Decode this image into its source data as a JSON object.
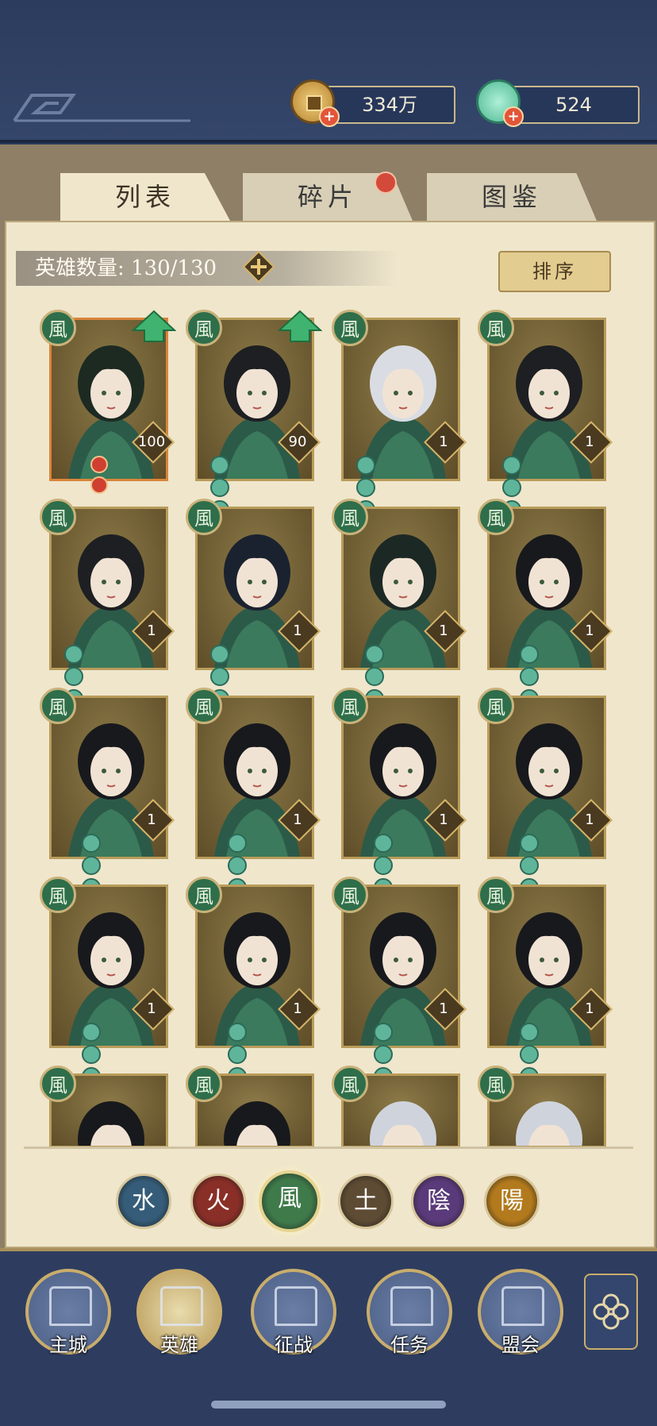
{
  "currency": {
    "coins": {
      "icon": "copper-coin-icon",
      "value": "334万"
    },
    "gems": {
      "icon": "jade-shell-icon",
      "value": "524"
    }
  },
  "tabs": [
    {
      "label": "列表",
      "active": true
    },
    {
      "label": "碎片",
      "active": false,
      "has_notification": true
    },
    {
      "label": "图鉴",
      "active": false
    }
  ],
  "hero_count": {
    "label": "英雄数量:",
    "value": "130/130"
  },
  "sort_button": "排序",
  "heroes": [
    {
      "element": "風",
      "level": "100",
      "stars": 2,
      "star_type": "red",
      "upgrade": true,
      "rarity": "gold",
      "portrait": "green-robed-heroine"
    },
    {
      "element": "風",
      "level": "90",
      "stars": 5,
      "star_type": "jade",
      "upgrade": true,
      "rarity": "normal",
      "portrait": "flower-hairpin-heroine"
    },
    {
      "element": "風",
      "level": "1",
      "stars": 5,
      "star_type": "jade",
      "upgrade": false,
      "rarity": "normal",
      "portrait": "masked-white-haired-hero"
    },
    {
      "element": "風",
      "level": "1",
      "stars": 5,
      "star_type": "jade",
      "upgrade": false,
      "rarity": "normal",
      "portrait": "flower-hairpin-heroine"
    },
    {
      "element": "風",
      "level": "1",
      "stars": 5,
      "star_type": "jade",
      "upgrade": false,
      "rarity": "normal",
      "portrait": "flower-hairpin-heroine"
    },
    {
      "element": "風",
      "level": "1",
      "stars": 5,
      "star_type": "jade",
      "upgrade": false,
      "rarity": "normal",
      "portrait": "long-haired-armored-hero"
    },
    {
      "element": "風",
      "level": "1",
      "stars": 4,
      "star_type": "jade",
      "upgrade": false,
      "rarity": "normal",
      "portrait": "swordsman-hero"
    },
    {
      "element": "風",
      "level": "1",
      "stars": 3,
      "star_type": "jade",
      "upgrade": false,
      "rarity": "normal",
      "portrait": "bob-haired-heroine"
    },
    {
      "element": "風",
      "level": "1",
      "stars": 3,
      "star_type": "jade",
      "upgrade": false,
      "rarity": "normal",
      "portrait": "bob-haired-heroine"
    },
    {
      "element": "風",
      "level": "1",
      "stars": 3,
      "star_type": "jade",
      "upgrade": false,
      "rarity": "normal",
      "portrait": "bob-haired-heroine"
    },
    {
      "element": "風",
      "level": "1",
      "stars": 3,
      "star_type": "jade",
      "upgrade": false,
      "rarity": "normal",
      "portrait": "bob-haired-heroine"
    },
    {
      "element": "風",
      "level": "1",
      "stars": 3,
      "star_type": "jade",
      "upgrade": false,
      "rarity": "normal",
      "portrait": "bob-haired-heroine"
    },
    {
      "element": "風",
      "level": "1",
      "stars": 3,
      "star_type": "jade",
      "upgrade": false,
      "rarity": "normal",
      "portrait": "bob-haired-heroine"
    },
    {
      "element": "風",
      "level": "1",
      "stars": 3,
      "star_type": "jade",
      "upgrade": false,
      "rarity": "normal",
      "portrait": "bob-haired-heroine"
    },
    {
      "element": "風",
      "level": "1",
      "stars": 3,
      "star_type": "jade",
      "upgrade": false,
      "rarity": "normal",
      "portrait": "bob-haired-heroine"
    },
    {
      "element": "風",
      "level": "1",
      "stars": 3,
      "star_type": "jade",
      "upgrade": false,
      "rarity": "normal",
      "portrait": "bob-haired-heroine"
    },
    {
      "element": "風",
      "level": "",
      "stars": 0,
      "star_type": "jade",
      "upgrade": false,
      "rarity": "normal",
      "portrait": "bob-haired-heroine"
    },
    {
      "element": "風",
      "level": "",
      "stars": 0,
      "star_type": "jade",
      "upgrade": false,
      "rarity": "normal",
      "portrait": "bob-haired-heroine"
    },
    {
      "element": "風",
      "level": "",
      "stars": 0,
      "star_type": "jade",
      "upgrade": false,
      "rarity": "normal",
      "portrait": "silver-haired-hero"
    },
    {
      "element": "風",
      "level": "",
      "stars": 0,
      "star_type": "jade",
      "upgrade": false,
      "rarity": "normal",
      "portrait": "silver-haired-hero"
    }
  ],
  "element_filters": [
    {
      "glyph": "水",
      "color": "#355c78",
      "selected": false
    },
    {
      "glyph": "火",
      "color": "#8a2f27",
      "selected": false
    },
    {
      "glyph": "風",
      "color": "#3f7a4a",
      "selected": true
    },
    {
      "glyph": "土",
      "color": "#5e4b33",
      "selected": false
    },
    {
      "glyph": "陰",
      "color": "#5a3a7a",
      "selected": false
    },
    {
      "glyph": "陽",
      "color": "#b27a1c",
      "selected": false
    }
  ],
  "nav": [
    {
      "label": "主城",
      "icon": "city-gate-icon"
    },
    {
      "label": "英雄",
      "icon": "hero-portrait-icon"
    },
    {
      "label": "征战",
      "icon": "war-drum-icon"
    },
    {
      "label": "任务",
      "icon": "scroll-bell-icon"
    },
    {
      "label": "盟会",
      "icon": "alliance-pavilion-icon"
    }
  ],
  "colors": {
    "accent": "#c9ad6c",
    "panel": "#efe6cc",
    "navy": "#2e3d5f"
  }
}
